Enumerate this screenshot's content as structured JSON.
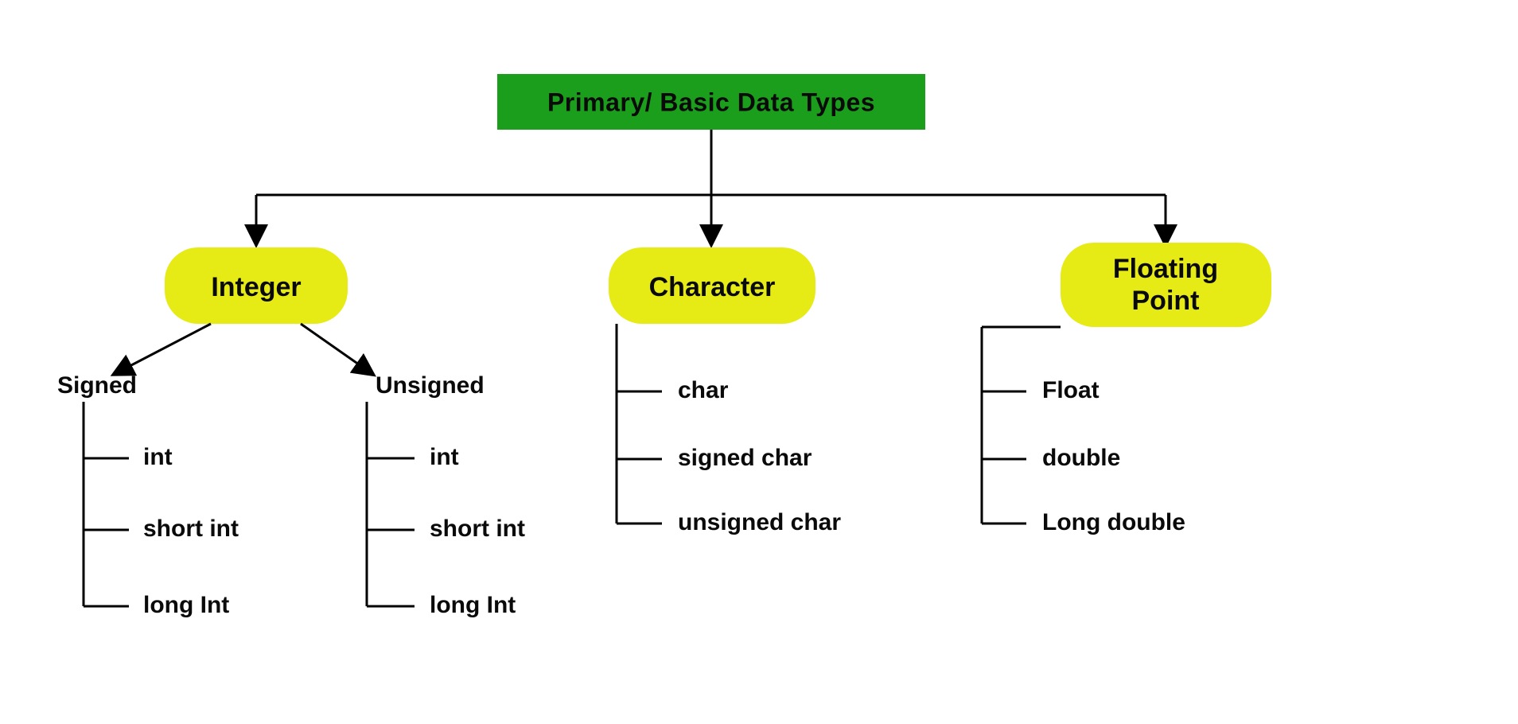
{
  "root": {
    "title": "Primary/ Basic Data Types"
  },
  "categories": [
    {
      "name": "Integer",
      "subgroups": [
        {
          "label": "Signed",
          "items": [
            "int",
            "short int",
            "long Int"
          ]
        },
        {
          "label": "Unsigned",
          "items": [
            "int",
            "short int",
            "long Int"
          ]
        }
      ]
    },
    {
      "name": "Character",
      "items": [
        "char",
        "signed char",
        "unsigned char"
      ]
    },
    {
      "name": "Floating Point",
      "items": [
        "Float",
        "double",
        "Long double"
      ]
    }
  ],
  "colors": {
    "root_bg": "#1b9e1b",
    "pill_bg": "#e6eb16",
    "text": "#0a0a0a"
  }
}
